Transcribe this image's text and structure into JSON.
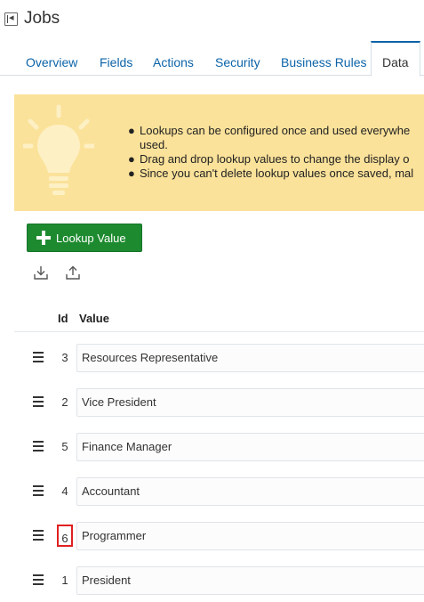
{
  "header": {
    "title": "Jobs",
    "back_icon": "collapse-panel-icon"
  },
  "tabs": [
    {
      "label": "Overview",
      "active": false
    },
    {
      "label": "Fields",
      "active": false
    },
    {
      "label": "Actions",
      "active": false
    },
    {
      "label": "Security",
      "active": false
    },
    {
      "label": "Business Rules",
      "active": false
    },
    {
      "label": "Data",
      "active": true
    }
  ],
  "banner": {
    "icon": "lightbulb-icon",
    "color": "#fbe29a",
    "bullets": [
      "Lookups can be configured once and used everywhe used.",
      "Drag and drop lookup values to change the display o",
      "Since you can't delete lookup values once saved, mal"
    ]
  },
  "toolbar": {
    "add_label": "Lookup Value",
    "add_color": "#1d8a2f",
    "download_icon": "download-icon",
    "upload_icon": "upload-icon"
  },
  "table": {
    "columns": [
      "Id",
      "Value"
    ],
    "rows": [
      {
        "id": "3",
        "value": "Resources Representative"
      },
      {
        "id": "2",
        "value": "Vice President"
      },
      {
        "id": "5",
        "value": "Finance Manager"
      },
      {
        "id": "4",
        "value": "Accountant"
      },
      {
        "id": "6",
        "value": "Programmer",
        "highlighted": true
      },
      {
        "id": "1",
        "value": "President"
      }
    ]
  }
}
